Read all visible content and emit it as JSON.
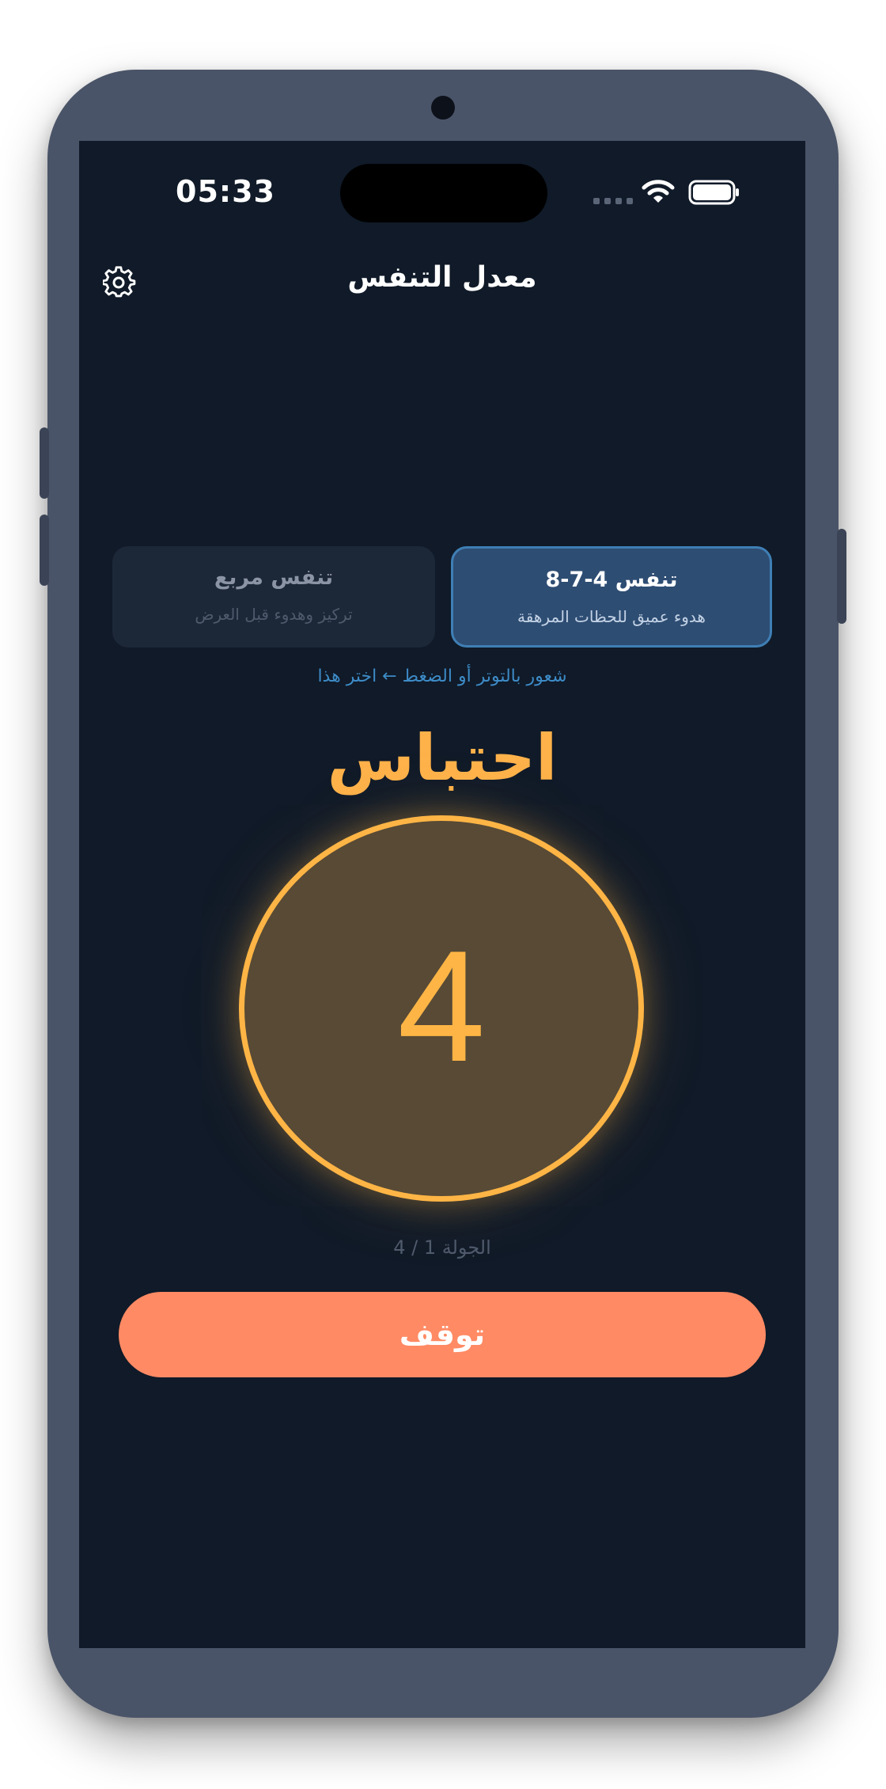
{
  "status_bar": {
    "time": "05:33"
  },
  "header": {
    "title": "معدل التنفس",
    "settings_icon": "gear-icon"
  },
  "modes": [
    {
      "title": "تنفس 4-7-8",
      "subtitle": "هدوء عميق للحظات المرهقة",
      "selected": true
    },
    {
      "title": "تنفس مربع",
      "subtitle": "تركيز وهدوء قبل العرض",
      "selected": false
    }
  ],
  "hint": "شعور بالتوتر أو الضغط ← اختر هذا",
  "session": {
    "phase": "احتباس",
    "countdown": "4",
    "round": "الجولة 1 / 4",
    "stop_label": "توقف"
  },
  "colors": {
    "background": "#101a28",
    "accent_amber": "#ffb545",
    "stop_button": "#ff8a64",
    "active_card": "#2e4d73",
    "hint_blue": "#3d8bc7"
  }
}
